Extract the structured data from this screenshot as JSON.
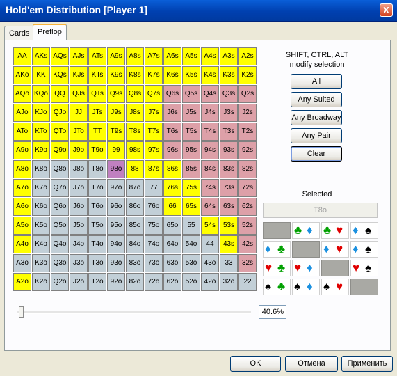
{
  "window": {
    "title": "Hold'em Distribution [Player 1]",
    "close": "X"
  },
  "tabs": [
    {
      "label": "Cards"
    },
    {
      "label": "Preflop"
    }
  ],
  "hands": [
    [
      "AA",
      "AKs",
      "AQs",
      "AJs",
      "ATs",
      "A9s",
      "A8s",
      "A7s",
      "A6s",
      "A5s",
      "A4s",
      "A3s",
      "A2s"
    ],
    [
      "AKo",
      "KK",
      "KQs",
      "KJs",
      "KTs",
      "K9s",
      "K8s",
      "K7s",
      "K6s",
      "K5s",
      "K4s",
      "K3s",
      "K2s"
    ],
    [
      "AQo",
      "KQo",
      "QQ",
      "QJs",
      "QTs",
      "Q9s",
      "Q8s",
      "Q7s",
      "Q6s",
      "Q5s",
      "Q4s",
      "Q3s",
      "Q2s"
    ],
    [
      "AJo",
      "KJo",
      "QJo",
      "JJ",
      "JTs",
      "J9s",
      "J8s",
      "J7s",
      "J6s",
      "J5s",
      "J4s",
      "J3s",
      "J2s"
    ],
    [
      "ATo",
      "KTo",
      "QTo",
      "JTo",
      "TT",
      "T9s",
      "T8s",
      "T7s",
      "T6s",
      "T5s",
      "T4s",
      "T3s",
      "T2s"
    ],
    [
      "A9o",
      "K9o",
      "Q9o",
      "J9o",
      "T9o",
      "99",
      "98s",
      "97s",
      "96s",
      "95s",
      "94s",
      "93s",
      "92s"
    ],
    [
      "A8o",
      "K8o",
      "Q8o",
      "J8o",
      "T8o",
      "98o",
      "88",
      "87s",
      "86s",
      "85s",
      "84s",
      "83s",
      "82s"
    ],
    [
      "A7o",
      "K7o",
      "Q7o",
      "J7o",
      "T7o",
      "97o",
      "87o",
      "77",
      "76s",
      "75s",
      "74s",
      "73s",
      "72s"
    ],
    [
      "A6o",
      "K6o",
      "Q6o",
      "J6o",
      "T6o",
      "96o",
      "86o",
      "76o",
      "66",
      "65s",
      "64s",
      "63s",
      "62s"
    ],
    [
      "A5o",
      "K5o",
      "Q5o",
      "J5o",
      "T5o",
      "95o",
      "85o",
      "75o",
      "65o",
      "55",
      "54s",
      "53s",
      "52s"
    ],
    [
      "A4o",
      "K4o",
      "Q4o",
      "J4o",
      "T4o",
      "94o",
      "84o",
      "74o",
      "64o",
      "54o",
      "44",
      "43s",
      "42s"
    ],
    [
      "A3o",
      "K3o",
      "Q3o",
      "J3o",
      "T3o",
      "93o",
      "83o",
      "73o",
      "63o",
      "53o",
      "43o",
      "33",
      "32s"
    ],
    [
      "A2o",
      "K2o",
      "Q2o",
      "J2o",
      "T2o",
      "92o",
      "82o",
      "72o",
      "62o",
      "52o",
      "42o",
      "32o",
      "22"
    ]
  ],
  "hand_states": [
    "yyyyyyyyyyyyy",
    "yyyyyyyyyyyyy",
    "yyyyyyyyrrrrr",
    "yyyyyyyyrrrrr",
    "yyyyyyyyrrrrr",
    "yyyyyyyyrrrrr",
    "yggggpyyyrrrrr",
    "ygggggggyyrrr",
    "ygggggggyyrrr",
    "ygggggggggyyr",
    "yggggggggggyr",
    "ggggggggggggr",
    "yggggggggggggy"
  ],
  "state_colors": {
    "y": "#ffff00",
    "r": "#dda0a8",
    "g": "#c2cfd7",
    "p": "#c080c0"
  },
  "modifier_hint": [
    "SHIFT, CTRL, ALT",
    "modify selection"
  ],
  "buttons": {
    "all": "All",
    "any_suited": "Any Suited",
    "any_broadway": "Any Broadway",
    "any_pair": "Any Pair",
    "clear": "Clear"
  },
  "selected": {
    "label": "Selected",
    "value": "T8o"
  },
  "suit_combos": [
    [
      null,
      [
        "club",
        "diamond"
      ],
      [
        "club",
        "heart"
      ],
      [
        "diamond",
        "spade"
      ]
    ],
    [
      [
        "diamond",
        "club"
      ],
      null,
      [
        "diamond",
        "heart"
      ],
      [
        "diamond",
        "spade"
      ]
    ],
    [
      [
        "heart",
        "club"
      ],
      [
        "heart",
        "diamond"
      ],
      null,
      [
        "heart",
        "spade"
      ]
    ],
    [
      [
        "spade",
        "club"
      ],
      [
        "spade",
        "diamond"
      ],
      [
        "spade",
        "heart"
      ],
      null
    ]
  ],
  "slider": {
    "percent": "40.6%",
    "fraction": 0.0
  },
  "footer": {
    "ok": "OK",
    "cancel": "Отмена",
    "apply": "Применить"
  }
}
